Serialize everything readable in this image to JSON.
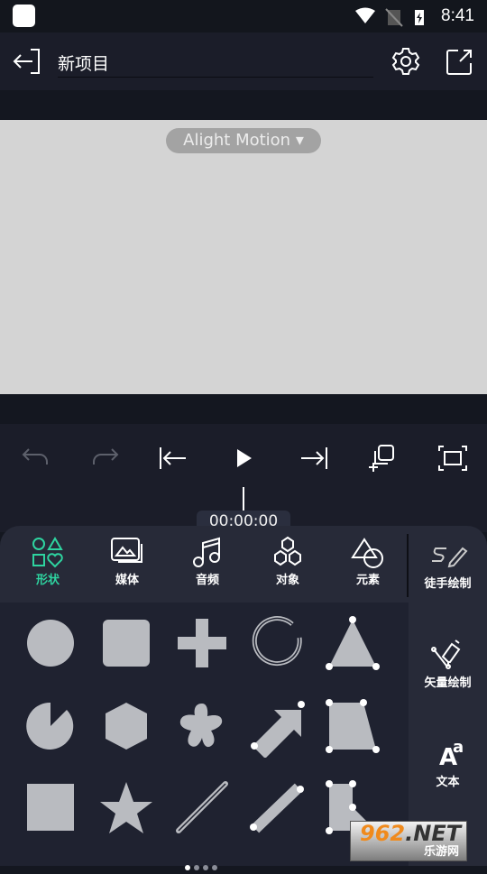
{
  "status_bar": {
    "time": "8:41"
  },
  "header": {
    "title": "新项目",
    "back_icon": "exit-icon",
    "settings_icon": "gear-icon",
    "export_icon": "export-icon"
  },
  "canvas": {
    "project_label": "Alight Motion ▾",
    "background": "#d4d4d4"
  },
  "playback": {
    "timecode": "00:00:00",
    "buttons": [
      "undo",
      "redo",
      "jump-to-start",
      "play",
      "jump-to-end",
      "add-layer",
      "fit-screen"
    ]
  },
  "tabs": [
    {
      "label": "形状",
      "active": true
    },
    {
      "label": "媒体"
    },
    {
      "label": "音频"
    },
    {
      "label": "对象"
    },
    {
      "label": "元素"
    }
  ],
  "side_tools": [
    {
      "label": "徒手绘制"
    },
    {
      "label": "矢量绘制"
    },
    {
      "label": "文本"
    }
  ],
  "shapes": [
    "circle",
    "rounded-square",
    "cross",
    "ring",
    "triangle",
    "pie",
    "hexagon",
    "flower",
    "arrow",
    "trapezoid",
    "square",
    "star",
    "line",
    "thick-line",
    "polygon"
  ],
  "pagination": {
    "pages": 4,
    "current": 1
  },
  "colors": {
    "accent": "#2ed4a0",
    "shape": "#b9bbc0"
  },
  "watermark": {
    "text": "962.NET",
    "subtext": "乐游网"
  }
}
